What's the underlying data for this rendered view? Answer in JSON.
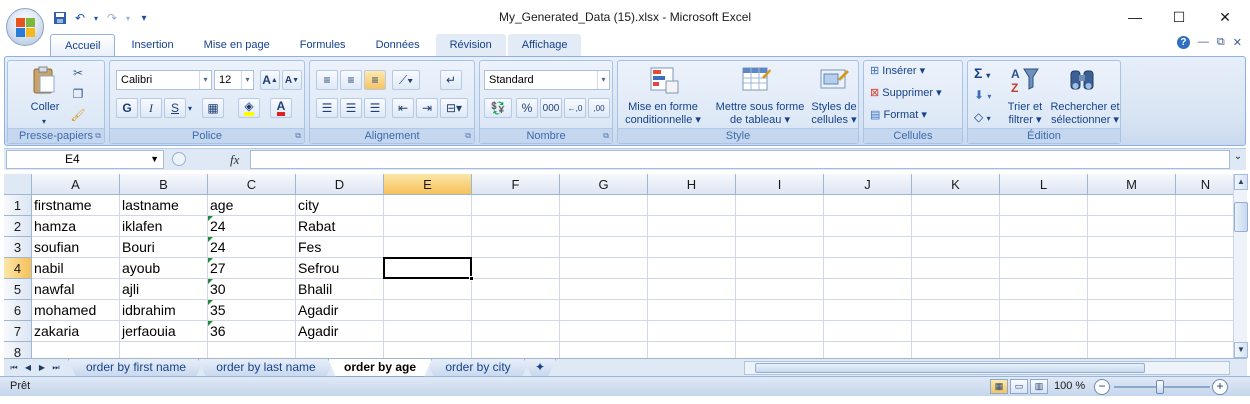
{
  "window": {
    "title": "My_Generated_Data (15).xlsx - Microsoft Excel",
    "controls": {
      "minimize": "—",
      "maximize": "☐",
      "close": "✕"
    }
  },
  "quick_access": {
    "save": "save-icon",
    "undo": "↶",
    "redo": "↷",
    "customize": "▾"
  },
  "ribbon_tabs": {
    "items": [
      "Accueil",
      "Insertion",
      "Mise en page",
      "Formules",
      "Données",
      "Révision",
      "Affichage"
    ],
    "active": "Accueil",
    "help": "?",
    "minimize": "—",
    "restore": "⧉",
    "close": "✕"
  },
  "ribbon": {
    "clipboard": {
      "label": "Presse-papiers",
      "paste": "Coller"
    },
    "font": {
      "label": "Police",
      "font_name": "Calibri",
      "font_size": "12",
      "bold": "G",
      "italic": "I",
      "underline": "S",
      "grow": "A",
      "shrink": "A",
      "font_color": "A"
    },
    "alignment": {
      "label": "Alignement"
    },
    "number": {
      "label": "Nombre",
      "format": "Standard",
      "percent": "%",
      "thousands": "000",
      "inc_decimal": "←,0",
      "dec_decimal": ",00"
    },
    "style": {
      "label": "Style",
      "conditional": [
        "Mise en forme",
        "conditionnelle"
      ],
      "as_table": [
        "Mettre sous forme",
        "de tableau"
      ],
      "cell_styles": [
        "Styles de",
        "cellules"
      ]
    },
    "cells": {
      "label": "Cellules",
      "insert": "Insérer",
      "delete": "Supprimer",
      "format": "Format"
    },
    "editing": {
      "label": "Édition",
      "sort_filter": [
        "Trier et",
        "filtrer"
      ],
      "find_select": [
        "Rechercher et",
        "sélectionner"
      ]
    }
  },
  "formula_bar": {
    "name_box": "E4",
    "fx": "fx",
    "formula": ""
  },
  "sheet": {
    "columns": [
      "A",
      "B",
      "C",
      "D",
      "E",
      "F",
      "G",
      "H",
      "I",
      "J",
      "K",
      "L",
      "M",
      "N"
    ],
    "selected_column": "E",
    "selected_row": "4",
    "row_numbers": [
      "1",
      "2",
      "3",
      "4",
      "5",
      "6",
      "7",
      "8"
    ],
    "rows": [
      [
        "firstname",
        "lastname",
        "age",
        "city"
      ],
      [
        "hamza",
        "iklafen",
        "24",
        "Rabat"
      ],
      [
        "soufian",
        "Bouri",
        "24",
        "Fes"
      ],
      [
        "nabil",
        "ayoub",
        "27",
        "Sefrou"
      ],
      [
        "nawfal",
        "ajli",
        "30",
        "Bhalil"
      ],
      [
        "mohamed",
        "idbrahim",
        "35",
        "Agadir"
      ],
      [
        "zakaria",
        "jerfaouia",
        "36",
        "Agadir"
      ],
      [
        "",
        "",
        "",
        ""
      ]
    ],
    "number_as_text_indicator_color": "#1e8b3a"
  },
  "sheet_tabs": {
    "items": [
      "order by first name",
      "order by last name",
      "order by age",
      "order by city"
    ],
    "active": "order by age",
    "new_sheet": "new-sheet-icon"
  },
  "status_bar": {
    "status": "Prêt",
    "zoom": "100 %",
    "zoom_minus": "−",
    "zoom_plus": "+"
  },
  "colors": {
    "selection_header": "#f6c15a",
    "ribbon_bg": "#dde8f6",
    "header_text": "#15428b"
  }
}
